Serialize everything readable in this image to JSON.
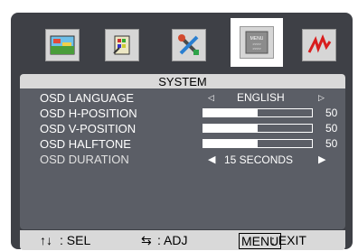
{
  "tabs": [
    {
      "icon": "picture-icon"
    },
    {
      "icon": "color-palette-icon"
    },
    {
      "icon": "tools-icon"
    },
    {
      "icon": "menu-icon",
      "label": "MENU",
      "selected": true
    },
    {
      "icon": "signal-icon"
    }
  ],
  "title": "SYSTEM",
  "rows": {
    "language": {
      "label": "OSD LANGUAGE",
      "value": "ENGLISH"
    },
    "hpos": {
      "label": "OSD H-POSITION",
      "value": "50",
      "level": 0.5
    },
    "vpos": {
      "label": "OSD V-POSITION",
      "value": "50",
      "level": 0.5
    },
    "halftone": {
      "label": "OSD HALFTONE",
      "value": "50",
      "level": 0.5
    },
    "duration": {
      "label": "OSD DURATION",
      "value": "15 SECONDS"
    }
  },
  "footer": {
    "sel_arrows": "↑↓",
    "sel_label": ": SEL",
    "adj_arrows": "⇆",
    "adj_label": ": ADJ",
    "menu_key": "MENU",
    "exit_label": ": EXIT"
  },
  "colors": {
    "osd_background": "#3e4046",
    "panel": "#5b5e66",
    "header": "#d9d9d9"
  }
}
